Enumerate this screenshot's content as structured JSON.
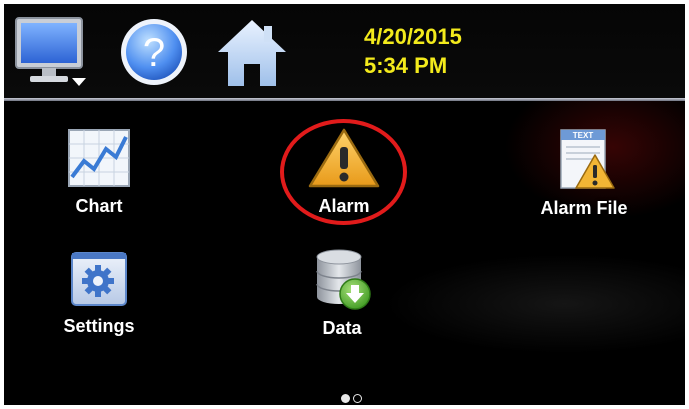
{
  "topbar": {
    "icons": [
      {
        "name": "monitor-icon"
      },
      {
        "name": "help-icon",
        "glyph": "?"
      },
      {
        "name": "home-icon"
      }
    ],
    "date": "4/20/2015",
    "time": "5:34 PM",
    "text_color": "#f3ea1c"
  },
  "apps": [
    {
      "id": "chart",
      "label": "Chart",
      "icon": "chart-icon"
    },
    {
      "id": "alarm",
      "label": "Alarm",
      "icon": "warning-icon",
      "highlighted": true
    },
    {
      "id": "alarm_file",
      "label": "Alarm File",
      "icon": "alarm-file-icon",
      "badge": "TEXT"
    },
    {
      "id": "settings",
      "label": "Settings",
      "icon": "gear-icon"
    },
    {
      "id": "data",
      "label": "Data",
      "icon": "database-download-icon"
    }
  ],
  "highlight_color": "#e11b1b",
  "pager": {
    "pages": 2,
    "current": 1
  }
}
